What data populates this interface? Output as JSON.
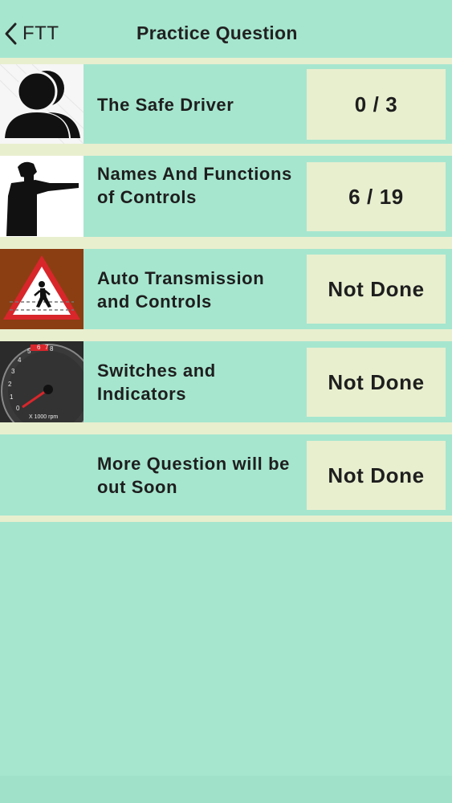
{
  "nav": {
    "back_label": "FTT",
    "title": "Practice Question"
  },
  "rows": [
    {
      "label": "The Safe Driver",
      "status": "0 / 3",
      "icon": "person-avatar-icon"
    },
    {
      "label": "Names And Functions of Controls",
      "status": "6 / 19",
      "icon": "pointing-officer-icon"
    },
    {
      "label": "Auto Transmission and Controls",
      "status": "Not Done",
      "icon": "pedestrian-crossing-sign-icon"
    },
    {
      "label": "Switches and Indicators",
      "status": "Not Done",
      "icon": "tachometer-icon",
      "gauge_caption": "X 1000 rpm"
    },
    {
      "label": "More Question will be out Soon",
      "status": "Not Done",
      "icon": ""
    }
  ],
  "colors": {
    "background": "#a6e6cf",
    "separator": "#e8efcf",
    "status_box": "#e8efcf",
    "sign_brown": "#8b3e12",
    "sign_red": "#d8262b"
  }
}
